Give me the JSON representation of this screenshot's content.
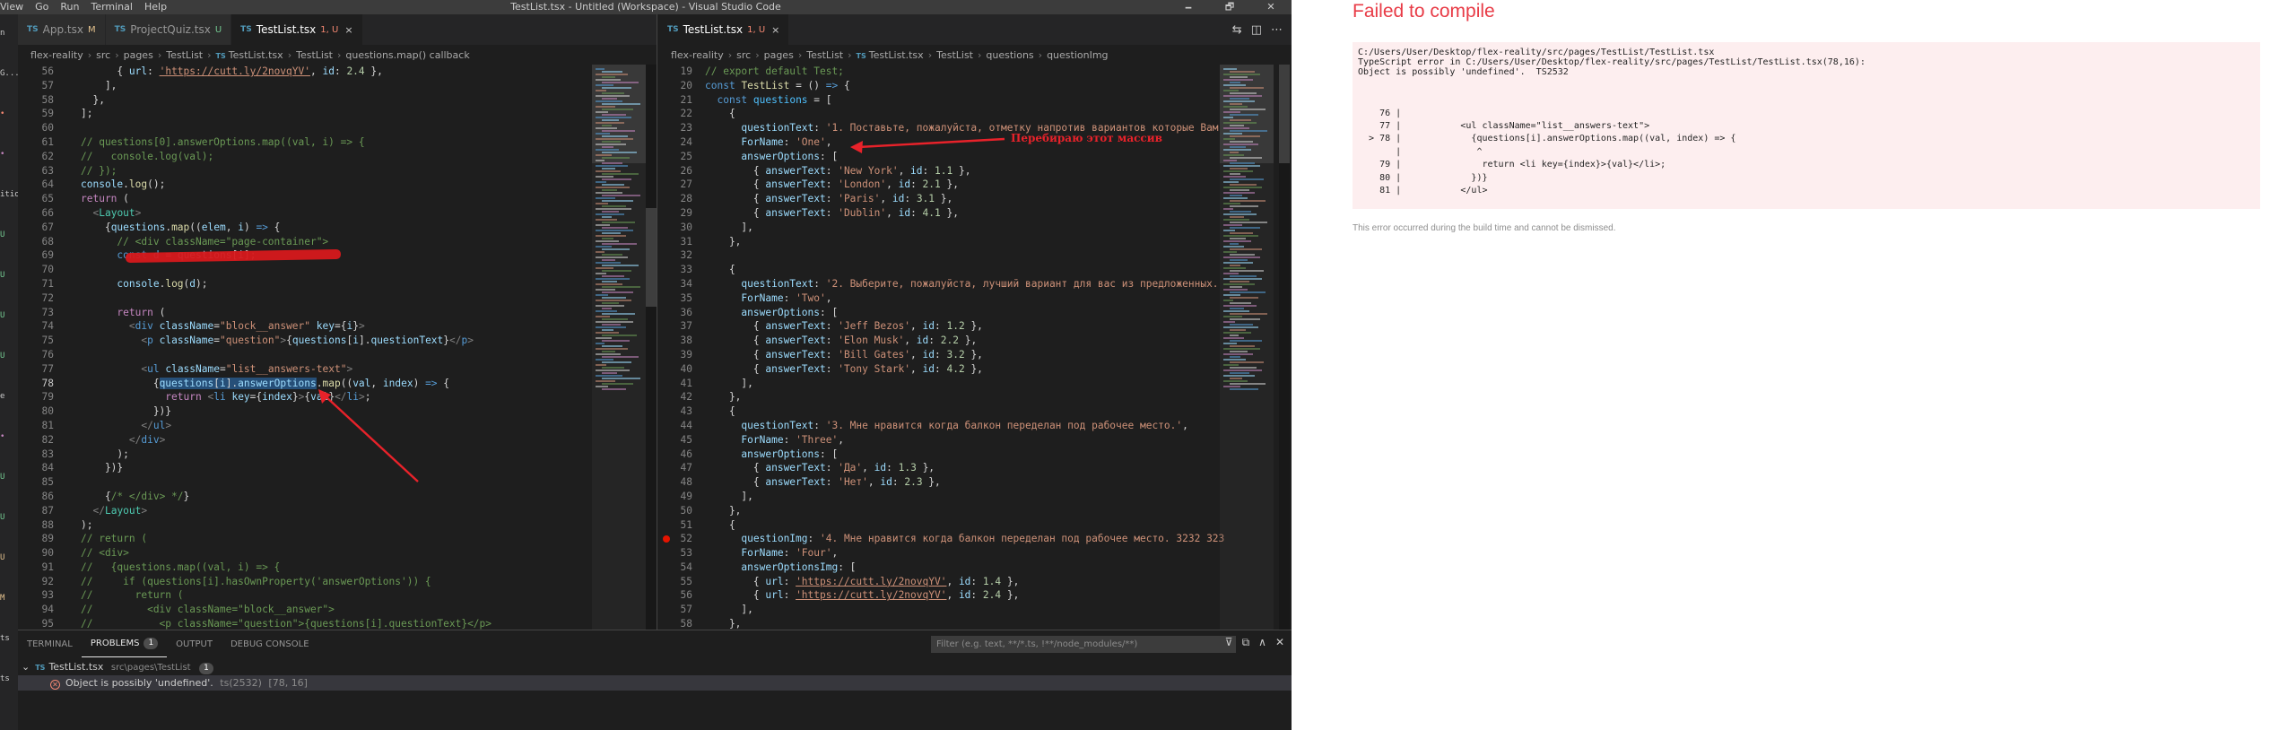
{
  "titlebar": {
    "menu": [
      "View",
      "Go",
      "Run",
      "Terminal",
      "Help"
    ],
    "title": "TestList.tsx - Untitled (Workspace) - Visual Studio Code",
    "controls": [
      "🗕",
      "🗗",
      "✕"
    ]
  },
  "activity_marks": [
    {
      "text": "n",
      "color": "#cccccc"
    },
    {
      "text": "G...",
      "color": "#cccccc"
    },
    {
      "text": "•",
      "color": "#f48771"
    },
    {
      "text": "•",
      "color": "#c586c0"
    },
    {
      "text": "ition",
      "color": "#cccccc"
    },
    {
      "text": "U",
      "color": "#73c991"
    },
    {
      "text": "U",
      "color": "#73c991"
    },
    {
      "text": "U",
      "color": "#73c991"
    },
    {
      "text": "U",
      "color": "#73c991"
    },
    {
      "text": "e",
      "color": "#cccccc"
    },
    {
      "text": "•",
      "color": "#c586c0"
    },
    {
      "text": "U",
      "color": "#73c991"
    },
    {
      "text": "U",
      "color": "#73c991"
    },
    {
      "text": "U",
      "color": "#e2c08d"
    },
    {
      "text": "M",
      "color": "#e2c08d"
    },
    {
      "text": "ts",
      "color": "#cccccc"
    },
    {
      "text": "ts",
      "color": "#cccccc"
    }
  ],
  "left_editor": {
    "tabs": [
      {
        "label": "App.tsx",
        "status": "M",
        "status_color": "#e2c08d",
        "active": false
      },
      {
        "label": "ProjectQuiz.tsx",
        "status": "U",
        "status_color": "#73c991",
        "active": false
      },
      {
        "label": "TestList.tsx",
        "status": "1, U",
        "status_color": "#f48771",
        "active": true
      }
    ],
    "breadcrumb": [
      "flex-reality",
      "src",
      "pages",
      "TestList",
      "TestList.tsx",
      "TestList",
      "questions.map() callback"
    ],
    "lines": [
      {
        "n": "56",
        "html": "      { <span class=\"c-var\">url</span>: <span class=\"c-url\">'https://cutt.ly/2novqYV'</span>, <span class=\"c-var\">id</span>: <span class=\"c-num\">2.4</span> },"
      },
      {
        "n": "57",
        "html": "    ],"
      },
      {
        "n": "58",
        "html": "  },"
      },
      {
        "n": "59",
        "html": "];"
      },
      {
        "n": "60",
        "html": ""
      },
      {
        "n": "61",
        "html": "<span class=\"c-cmt\">// questions[0].answerOptions.map((val, i) =&gt; {</span>"
      },
      {
        "n": "62",
        "html": "<span class=\"c-cmt\">//   console.log(val);</span>"
      },
      {
        "n": "63",
        "html": "<span class=\"c-cmt\">// });</span>"
      },
      {
        "n": "64",
        "html": "<span class=\"c-var\">console</span>.<span class=\"c-fn\">log</span>();"
      },
      {
        "n": "65",
        "html": "<span class=\"c-ctl\">return</span> ("
      },
      {
        "n": "66",
        "html": "  <span class=\"c-ang\">&lt;</span><span class=\"c-tag\">Layout</span><span class=\"c-ang\">&gt;</span>"
      },
      {
        "n": "67",
        "html": "    {<span class=\"c-var\">questions</span>.<span class=\"c-fn\">map</span>((<span class=\"c-var\">elem</span>, <span class=\"c-var\">i</span>) <span class=\"c-kw\">=&gt;</span> {"
      },
      {
        "n": "68",
        "html": "      <span class=\"c-cmt\">// &lt;div className=\"page-container\"&gt;</span>"
      },
      {
        "n": "69",
        "html": "      <span class=\"c-kw\">const</span> <span class=\"c-const\">d</span> = <span class=\"c-var\">questions</span>[<span class=\"c-var\">i</span>];",
        "redact": true
      },
      {
        "n": "70",
        "html": ""
      },
      {
        "n": "71",
        "html": "      <span class=\"c-var\">console</span>.<span class=\"c-fn\">log</span>(<span class=\"c-var\">d</span>);"
      },
      {
        "n": "72",
        "html": ""
      },
      {
        "n": "73",
        "html": "      <span class=\"c-ctl\">return</span> ("
      },
      {
        "n": "74",
        "html": "        <span class=\"c-ang\">&lt;</span><span class=\"c-kw\">div</span> <span class=\"c-var\">className</span>=<span class=\"c-str\">\"block__answer\"</span> <span class=\"c-var\">key</span>={<span class=\"c-var\">i</span>}<span class=\"c-ang\">&gt;</span>"
      },
      {
        "n": "75",
        "html": "          <span class=\"c-ang\">&lt;</span><span class=\"c-kw\">p</span> <span class=\"c-var\">className</span>=<span class=\"c-str\">\"question\"</span><span class=\"c-ang\">&gt;</span>{<span class=\"c-var\">questions</span>[<span class=\"c-var\">i</span>].<span class=\"c-var\">questionText</span>}<span class=\"c-ang\">&lt;/</span><span class=\"c-kw\">p</span><span class=\"c-ang\">&gt;</span>"
      },
      {
        "n": "76",
        "html": ""
      },
      {
        "n": "77",
        "html": "          <span class=\"c-ang\">&lt;</span><span class=\"c-kw\">ul</span> <span class=\"c-var\">className</span>=<span class=\"c-str\">\"list__answers-text\"</span><span class=\"c-ang\">&gt;</span>"
      },
      {
        "n": "78",
        "html": "            {<span class=\"selected\"><span class=\"c-var\">questions</span>[<span class=\"c-var\">i</span>].<span class=\"c-var\">answerOptions</span></span>.<span class=\"c-fn\">map</span>((<span class=\"c-var\">val</span>, <span class=\"c-var\">index</span>) <span class=\"c-kw\">=&gt;</span> {",
        "current": true
      },
      {
        "n": "79",
        "html": "              <span class=\"c-ctl\">return</span> <span class=\"c-ang\">&lt;</span><span class=\"c-kw\">li</span> <span class=\"c-var\">key</span>={<span class=\"c-var\">index</span>}<span class=\"c-ang\">&gt;</span>{<span class=\"c-var\">val</span>}<span class=\"c-ang\">&lt;/</span><span class=\"c-kw\">li</span><span class=\"c-ang\">&gt;</span>;"
      },
      {
        "n": "80",
        "html": "            })}"
      },
      {
        "n": "81",
        "html": "          <span class=\"c-ang\">&lt;/</span><span class=\"c-kw\">ul</span><span class=\"c-ang\">&gt;</span>"
      },
      {
        "n": "82",
        "html": "        <span class=\"c-ang\">&lt;/</span><span class=\"c-kw\">div</span><span class=\"c-ang\">&gt;</span>"
      },
      {
        "n": "83",
        "html": "      );"
      },
      {
        "n": "84",
        "html": "    })}"
      },
      {
        "n": "85",
        "html": ""
      },
      {
        "n": "86",
        "html": "    {<span class=\"c-cmt\">/* &lt;/div&gt; */</span>}"
      },
      {
        "n": "87",
        "html": "  <span class=\"c-ang\">&lt;/</span><span class=\"c-tag\">Layout</span><span class=\"c-ang\">&gt;</span>"
      },
      {
        "n": "88",
        "html": ");"
      },
      {
        "n": "89",
        "html": "<span class=\"c-cmt\">// return (</span>"
      },
      {
        "n": "90",
        "html": "<span class=\"c-cmt\">// &lt;div&gt;</span>"
      },
      {
        "n": "91",
        "html": "<span class=\"c-cmt\">//   {questions.map((val, i) =&gt; {</span>"
      },
      {
        "n": "92",
        "html": "<span class=\"c-cmt\">//     if (questions[i].hasOwnProperty('answerOptions')) {</span>"
      },
      {
        "n": "93",
        "html": "<span class=\"c-cmt\">//       return (</span>"
      },
      {
        "n": "94",
        "html": "<span class=\"c-cmt\">//         &lt;div className=\"block__answer\"&gt;</span>"
      },
      {
        "n": "95",
        "html": "<span class=\"c-cmt\">//           &lt;p className=\"question\"&gt;{questions[i].questionText}&lt;/p&gt;</span>"
      }
    ]
  },
  "right_editor": {
    "tabs": [
      {
        "label": "TestList.tsx",
        "status": "1, U",
        "status_color": "#f48771",
        "active": true
      }
    ],
    "breadcrumb": [
      "flex-reality",
      "src",
      "pages",
      "TestList",
      "TestList.tsx",
      "TestList",
      "questions",
      "questionImg"
    ],
    "lines": [
      {
        "n": "19",
        "html": "<span class=\"c-cmt\">// export default Test;</span>"
      },
      {
        "n": "20",
        "html": "<span class=\"c-kw\">const</span> <span class=\"c-fn\">TestList</span> = () <span class=\"c-kw\">=&gt;</span> {"
      },
      {
        "n": "21",
        "html": "  <span class=\"c-kw\">const</span> <span class=\"c-const\">questions</span> = ["
      },
      {
        "n": "22",
        "html": "    {"
      },
      {
        "n": "23",
        "html": "      <span class=\"c-var\">questionText</span>: <span class=\"c-str\">'1. Поставьте, пожалуйста, отметку напротив вариантов которые Вам</span>"
      },
      {
        "n": "24",
        "html": "      <span class=\"c-var\">ForName</span>: <span class=\"c-str\">'One'</span>,"
      },
      {
        "n": "25",
        "html": "      <span class=\"c-var\">answerOptions</span>: ["
      },
      {
        "n": "26",
        "html": "        { <span class=\"c-var\">answerText</span>: <span class=\"c-str\">'New York'</span>, <span class=\"c-var\">id</span>: <span class=\"c-num\">1.1</span> },"
      },
      {
        "n": "27",
        "html": "        { <span class=\"c-var\">answerText</span>: <span class=\"c-str\">'London'</span>, <span class=\"c-var\">id</span>: <span class=\"c-num\">2.1</span> },"
      },
      {
        "n": "28",
        "html": "        { <span class=\"c-var\">answerText</span>: <span class=\"c-str\">'Paris'</span>, <span class=\"c-var\">id</span>: <span class=\"c-num\">3.1</span> },"
      },
      {
        "n": "29",
        "html": "        { <span class=\"c-var\">answerText</span>: <span class=\"c-str\">'Dublin'</span>, <span class=\"c-var\">id</span>: <span class=\"c-num\">4.1</span> },"
      },
      {
        "n": "30",
        "html": "      ],"
      },
      {
        "n": "31",
        "html": "    },"
      },
      {
        "n": "32",
        "html": ""
      },
      {
        "n": "33",
        "html": "    {"
      },
      {
        "n": "34",
        "html": "      <span class=\"c-var\">questionText</span>: <span class=\"c-str\">'2. Выберите, пожалуйста, лучший вариант для вас из предложенных.</span>"
      },
      {
        "n": "35",
        "html": "      <span class=\"c-var\">ForName</span>: <span class=\"c-str\">'Two'</span>,"
      },
      {
        "n": "36",
        "html": "      <span class=\"c-var\">answerOptions</span>: ["
      },
      {
        "n": "37",
        "html": "        { <span class=\"c-var\">answerText</span>: <span class=\"c-str\">'Jeff Bezos'</span>, <span class=\"c-var\">id</span>: <span class=\"c-num\">1.2</span> },"
      },
      {
        "n": "38",
        "html": "        { <span class=\"c-var\">answerText</span>: <span class=\"c-str\">'Elon Musk'</span>, <span class=\"c-var\">id</span>: <span class=\"c-num\">2.2</span> },"
      },
      {
        "n": "39",
        "html": "        { <span class=\"c-var\">answerText</span>: <span class=\"c-str\">'Bill Gates'</span>, <span class=\"c-var\">id</span>: <span class=\"c-num\">3.2</span> },"
      },
      {
        "n": "40",
        "html": "        { <span class=\"c-var\">answerText</span>: <span class=\"c-str\">'Tony Stark'</span>, <span class=\"c-var\">id</span>: <span class=\"c-num\">4.2</span> },"
      },
      {
        "n": "41",
        "html": "      ],"
      },
      {
        "n": "42",
        "html": "    },"
      },
      {
        "n": "43",
        "html": "    {"
      },
      {
        "n": "44",
        "html": "      <span class=\"c-var\">questionText</span>: <span class=\"c-str\">'3. Мне нравится когда балкон переделан под рабочее место.'</span>,"
      },
      {
        "n": "45",
        "html": "      <span class=\"c-var\">ForName</span>: <span class=\"c-str\">'Three'</span>,"
      },
      {
        "n": "46",
        "html": "      <span class=\"c-var\">answerOptions</span>: ["
      },
      {
        "n": "47",
        "html": "        { <span class=\"c-var\">answerText</span>: <span class=\"c-str\">'Да'</span>, <span class=\"c-var\">id</span>: <span class=\"c-num\">1.3</span> },"
      },
      {
        "n": "48",
        "html": "        { <span class=\"c-var\">answerText</span>: <span class=\"c-str\">'Нет'</span>, <span class=\"c-var\">id</span>: <span class=\"c-num\">2.3</span> },"
      },
      {
        "n": "49",
        "html": "      ],"
      },
      {
        "n": "50",
        "html": "    },"
      },
      {
        "n": "51",
        "html": "    {"
      },
      {
        "n": "52",
        "html": "      <span class=\"c-var\">questionImg</span>: <span class=\"c-str\">'4. Мне нравится когда балкон переделан под рабочее место. 3232 323</span>",
        "breakpoint": true
      },
      {
        "n": "53",
        "html": "      <span class=\"c-var\">ForName</span>: <span class=\"c-str\">'Four'</span>,"
      },
      {
        "n": "54",
        "html": "      <span class=\"c-var\">answerOptionsImg</span>: ["
      },
      {
        "n": "55",
        "html": "        { <span class=\"c-var\">url</span>: <span class=\"c-url\">'https://cutt.ly/2novqYV'</span>, <span class=\"c-var\">id</span>: <span class=\"c-num\">1.4</span> },"
      },
      {
        "n": "56",
        "html": "        { <span class=\"c-var\">url</span>: <span class=\"c-url\">'https://cutt.ly/2novqYV'</span>, <span class=\"c-var\">id</span>: <span class=\"c-num\">2.4</span> },"
      },
      {
        "n": "57",
        "html": "      ],"
      },
      {
        "n": "58",
        "html": "    },"
      },
      {
        "n": "59",
        "html": "  ];"
      }
    ]
  },
  "annotation": {
    "label": "Перебираю этот массив",
    "color": "#e8222a"
  },
  "panel": {
    "tabs": [
      {
        "label": "TERMINAL",
        "active": false
      },
      {
        "label": "PROBLEMS",
        "active": true,
        "badge": "1"
      },
      {
        "label": "OUTPUT",
        "active": false
      },
      {
        "label": "DEBUG CONSOLE",
        "active": false
      }
    ],
    "filter_placeholder": "Filter (e.g. text, **/*.ts, !**/node_modules/**)",
    "actions": [
      "⊽",
      "⧉",
      "∧",
      "✕"
    ],
    "file_row": {
      "file": "TestList.tsx",
      "path": "src\\pages\\TestList",
      "count": "1"
    },
    "error_row": {
      "message": "Object is possibly 'undefined'.",
      "code": "ts(2532)",
      "position": "[78, 16]"
    }
  },
  "browser": {
    "title": "Failed to compile",
    "error_lines": [
      "C:/Users/User/Desktop/flex-reality/src/pages/TestList/TestList.tsx",
      "TypeScript error in C:/Users/User/Desktop/flex-reality/src/pages/TestList/TestList.tsx(78,16):",
      "Object is possibly 'undefined'.  TS2532",
      "",
      "    76 |",
      "    77 |           <ul className=\"list__answers-text\">",
      "  > 78 |             {questions[i].answerOptions.map((val, index) => {",
      "       |              ^",
      "    79 |               return <li key={index}>{val}</li>;",
      "    80 |             })}",
      "    81 |           </ul>"
    ],
    "hint": "This error occurred during the build time and cannot be dismissed."
  }
}
